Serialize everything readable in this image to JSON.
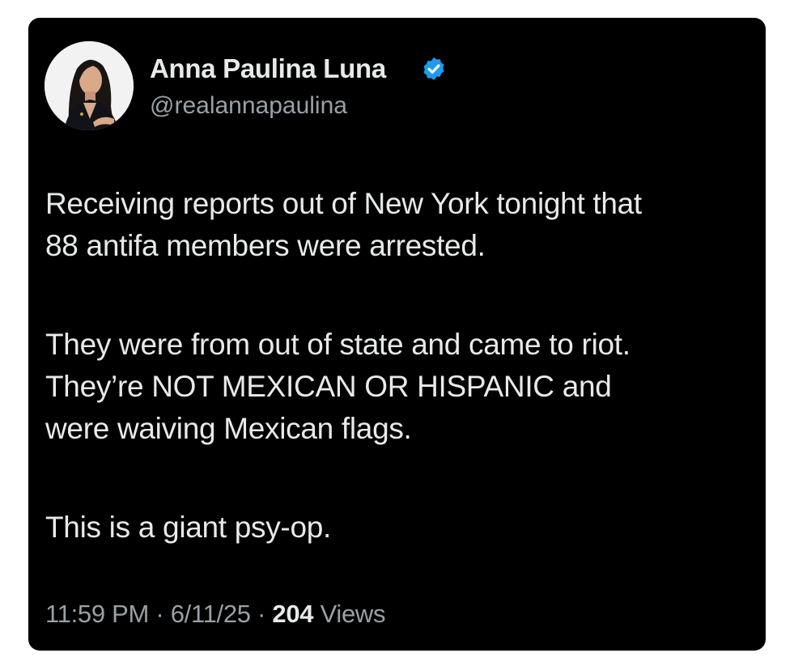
{
  "author": {
    "display_name": "Anna Paulina Luna",
    "handle": "@realannapaulina",
    "verified_icon": "verified-badge-icon",
    "avatar_icon": "profile-photo"
  },
  "tweet": {
    "paragraph_1": [
      "Receiving reports out of New York tonight that",
      "88 antifa members were arrested."
    ],
    "paragraph_2": [
      "They were from out of state and came to riot.",
      "They’re NOT MEXICAN OR HISPANIC and",
      "were waiving Mexican flags."
    ],
    "paragraph_3": [
      "This is  a giant psy-op."
    ]
  },
  "meta": {
    "time": "11:59 PM",
    "separator": "·",
    "date": "6/11/25",
    "views_count": "204",
    "views_label": "Views"
  },
  "colors": {
    "card_background": "#000000",
    "page_background": "#ffffff",
    "primary_text": "#e7e9ea",
    "secondary_text": "#9aa0a6",
    "verified_blue": "#1d9bf0"
  }
}
